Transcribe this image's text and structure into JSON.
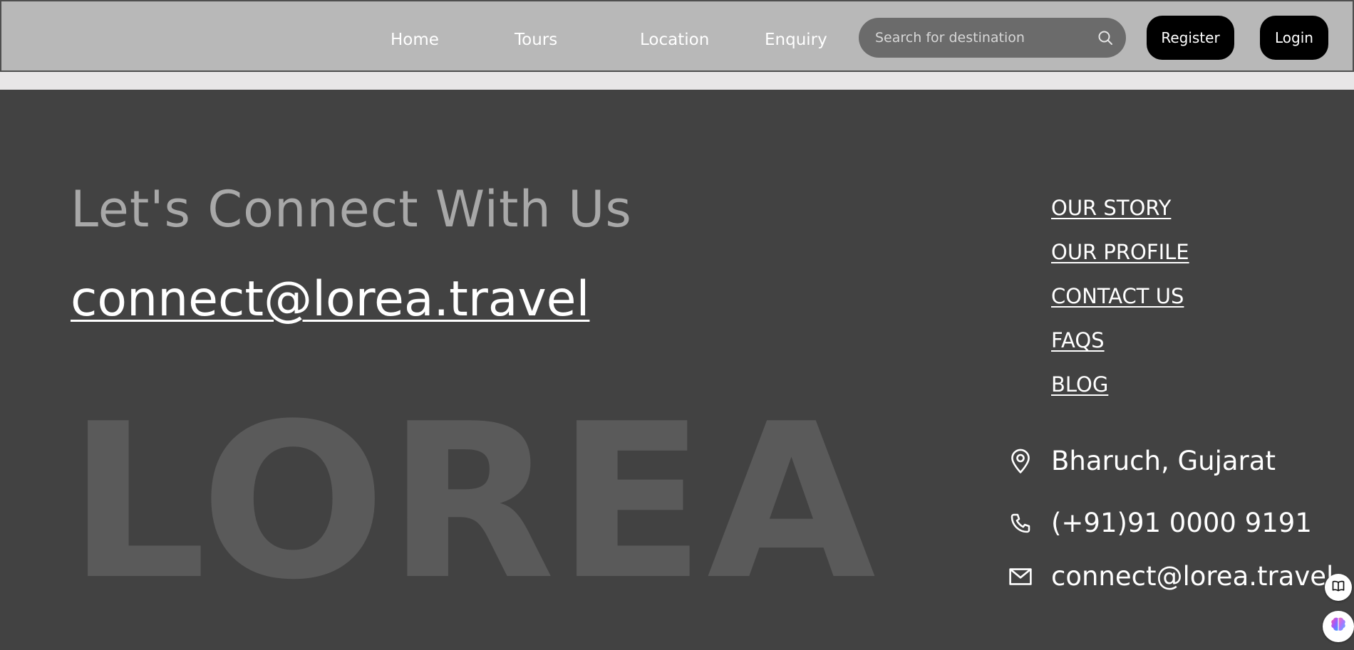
{
  "nav": {
    "items": [
      {
        "label": "Home"
      },
      {
        "label": "Tours"
      },
      {
        "label": "Location"
      },
      {
        "label": "Enquiry"
      }
    ],
    "search": {
      "placeholder": "Search for destination",
      "icon": "search-icon"
    },
    "register_label": "Register",
    "login_label": "Login"
  },
  "footer": {
    "heading": "Let's Connect With Us",
    "email_link": "connect@lorea.travel",
    "watermark": "LOREA",
    "links": [
      {
        "label": "OUR STORY"
      },
      {
        "label": "OUR PROFILE"
      },
      {
        "label": "CONTACT US"
      },
      {
        "label": "FAQS"
      },
      {
        "label": "BLOG"
      }
    ],
    "contact": {
      "location": {
        "icon": "location-pin-icon",
        "text": "Bharuch, Gujarat"
      },
      "phone": {
        "icon": "phone-icon",
        "text": "(+91)91 0000 9191"
      },
      "email": {
        "icon": "mail-icon",
        "text": "connect@lorea.travel"
      }
    }
  },
  "widgets": [
    {
      "icon": "book-icon"
    },
    {
      "icon": "brain-icon"
    }
  ],
  "colors": {
    "nav_background": "#b8b8b8",
    "search_background": "#6b6b6b",
    "button_background": "#000000",
    "footer_background": "#424242",
    "heading_text": "#a8a8a8",
    "watermark_text": "#5a5a5a",
    "strip": "#e8e6e7"
  }
}
